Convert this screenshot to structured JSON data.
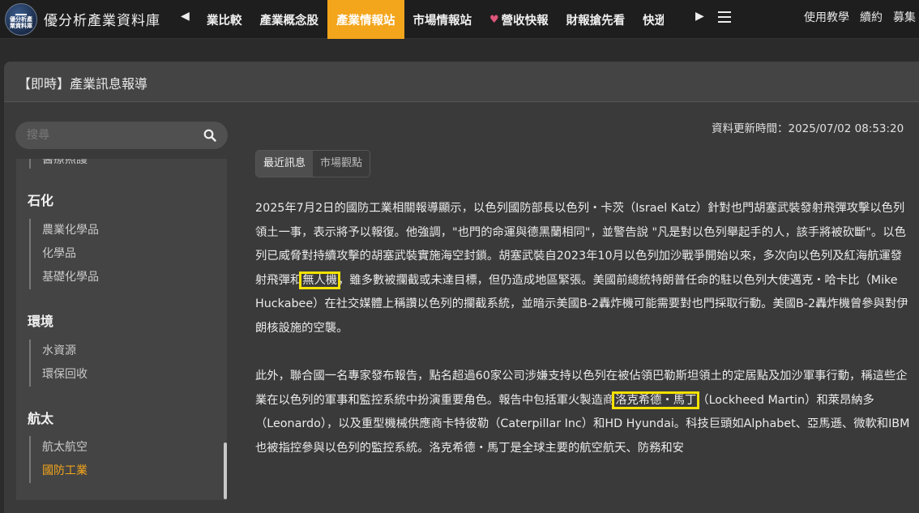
{
  "site": {
    "logo_text": "優分析產業資料庫",
    "title": "優分析產業資料庫"
  },
  "nav": {
    "prev_icon": "◀",
    "next_icon": "▶",
    "items": [
      {
        "label": "業比較",
        "active": false
      },
      {
        "label": "產業概念股",
        "active": false
      },
      {
        "label": "產業情報站",
        "active": true
      },
      {
        "label": "市場情報站",
        "active": false
      },
      {
        "label": "營收快報",
        "active": false,
        "icon": "heart-icon"
      },
      {
        "label": "財報搶先看",
        "active": false
      },
      {
        "label": "快逊",
        "active": false
      }
    ],
    "right_links": [
      "使用教學",
      "續約",
      "募集"
    ]
  },
  "panel": {
    "title": "【即時】產業訊息報導"
  },
  "search": {
    "placeholder": "搜尋"
  },
  "sidebar": {
    "partial_item": "醫療照護",
    "categories": [
      {
        "name": "石化",
        "items": [
          {
            "label": "農業化學品",
            "active": false
          },
          {
            "label": "化學品",
            "active": false
          },
          {
            "label": "基礎化學品",
            "active": false
          }
        ]
      },
      {
        "name": "環境",
        "items": [
          {
            "label": "水資源",
            "active": false
          },
          {
            "label": "環保回收",
            "active": false
          }
        ]
      },
      {
        "name": "航太",
        "items": [
          {
            "label": "航太航空",
            "active": false
          },
          {
            "label": "國防工業",
            "active": true
          }
        ]
      }
    ]
  },
  "content": {
    "updated_label": "資料更新時間：2025/07/02 08:53:20",
    "tabs": [
      {
        "label": "最近訊息",
        "active": true
      },
      {
        "label": "市場觀點",
        "active": false
      }
    ],
    "paragraphs": [
      {
        "segments": [
          {
            "text": "2025年7月2日的國防工業相關報導顯示，以色列國防部長以色列・卡茨（Israel Katz）針對也門胡塞武裝發射飛彈攻擊以色列領土一事，表示將予以報復。他強調，\"也門的命運與德黑蘭相同\"，並警告說 \"凡是對以色列舉起手的人，該手將被砍斷\"。以色列已威脅對持續攻擊的胡塞武裝實施海空封鎖。胡塞武裝自2023年10月以色列加沙戰爭開始以來，多次向以色列及紅海航運發射飛彈和",
            "highlight": false
          },
          {
            "text": "無人機",
            "highlight": true
          },
          {
            "text": "，雖多數被攔截或未達目標，但仍造成地區緊張。美國前總統特朗普任命的駐以色列大使邁克・哈卡比（Mike Huckabee）在社交媒體上稱讚以色列的攔截系統，並暗示美國B-2轟炸機可能需要對也門採取行動。美國B-2轟炸機曾參與對伊朗核設施的空襲。",
            "highlight": false
          }
        ]
      },
      {
        "segments": [
          {
            "text": "此外，聯合國一名專家發布報告，點名超過60家公司涉嫌支持以色列在被佔領巴勒斯坦領土的定居點及加沙軍事行動，稱這些企業在以色列的軍事和監控系統中扮演重要角色。報告中包括軍火製造商",
            "highlight": false
          },
          {
            "text": "洛克希德・馬丁",
            "highlight": true
          },
          {
            "text": "（Lockheed Martin）和萊昂納多（Leonardo），以及重型機械供應商卡特彼勒（Caterpillar Inc）和HD Hyundai。科技巨頭如Alphabet、亞馬遜、微軟和IBM也被指控參與以色列的監控系統。洛克希德・馬丁是全球主要的航空航天、防務和安",
            "highlight": false
          }
        ]
      }
    ]
  },
  "colors": {
    "accent": "#f3a51c",
    "highlight_box": "#f4e100",
    "background": "#2b2b2b",
    "panel": "#3a3a3a"
  }
}
